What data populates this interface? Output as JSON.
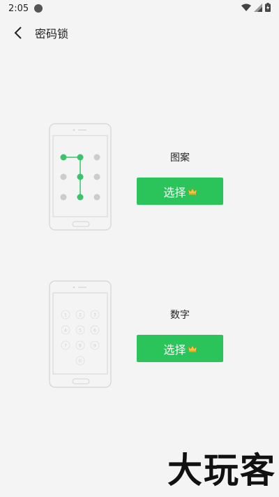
{
  "status_bar": {
    "time": "2:05"
  },
  "app_bar": {
    "title": "密码锁"
  },
  "options": [
    {
      "label": "图案",
      "button": "选择"
    },
    {
      "label": "数字",
      "button": "选择"
    }
  ],
  "keypad": [
    "1",
    "2",
    "3",
    "4",
    "5",
    "6",
    "7",
    "8",
    "9",
    "0"
  ],
  "colors": {
    "accent": "#2ac45a",
    "pattern_node_active": "#3cc46a",
    "pattern_node_inactive": "#cccccc",
    "background": "#f4f4f4"
  },
  "icons": {
    "back": "chevron-left-icon",
    "crown": "crown-icon",
    "wifi": "wifi-icon",
    "signal": "signal-icon",
    "battery": "battery-icon"
  },
  "watermark": "大玩客"
}
